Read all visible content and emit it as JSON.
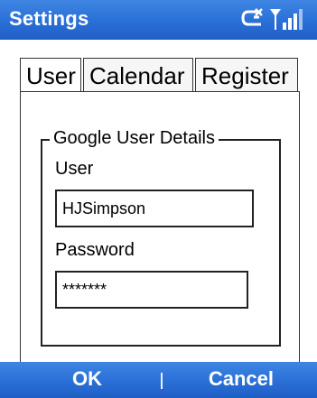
{
  "window": {
    "title": "Settings"
  },
  "status": {
    "icons": [
      "connection-icon",
      "signal-strength-icon"
    ]
  },
  "tabs": [
    {
      "label": "User",
      "active": true
    },
    {
      "label": "Calendar",
      "active": false
    },
    {
      "label": "Register",
      "active": false
    }
  ],
  "group": {
    "title": "Google User Details",
    "user_label": "User",
    "user_value": "HJSimpson",
    "password_label": "Password",
    "password_value": "*******"
  },
  "softkeys": {
    "left": "OK",
    "right": "Cancel"
  },
  "colors": {
    "bar_blue": "#2a6fd6",
    "text_white": "#ffffff"
  }
}
